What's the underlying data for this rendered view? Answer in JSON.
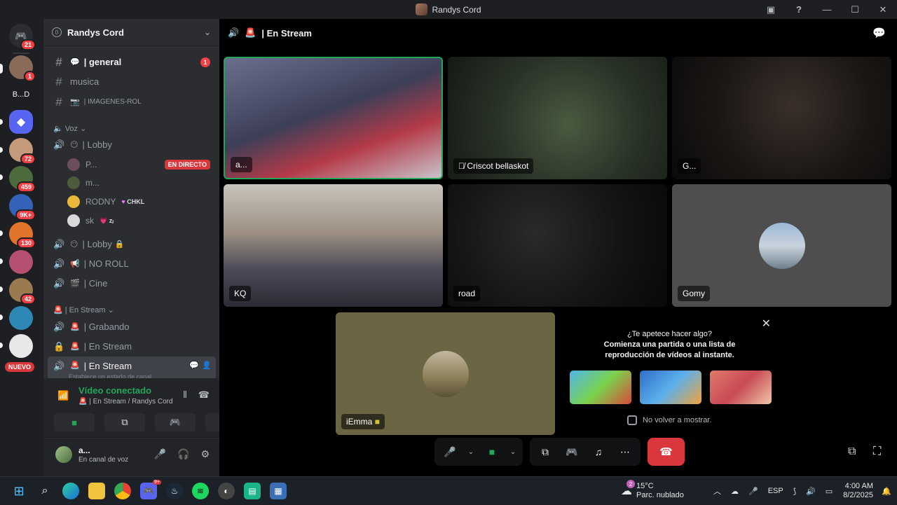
{
  "window": {
    "title": "Randys Cord"
  },
  "rail": {
    "servers": [
      {
        "badge": "21",
        "color": "#2b2d31"
      },
      {
        "badge": "1",
        "color": "#8a6a58"
      },
      {
        "label": "B...D",
        "color": "#1e1f22"
      },
      {
        "badge": "",
        "color": "#5865f2"
      },
      {
        "badge": "72",
        "color": "#c49a7a"
      },
      {
        "badge": "459",
        "color": "#4c6a3b"
      },
      {
        "badge": "9K+",
        "color": "#3462b8"
      },
      {
        "badge": "130",
        "color": "#e0742b"
      },
      {
        "badge": "",
        "color": "#b55070"
      },
      {
        "badge": "42",
        "color": "#9a7b4f"
      },
      {
        "badge": "",
        "color": "#2e88b5"
      },
      {
        "badge": "",
        "color": "#e8e8e8"
      },
      {
        "label": "NUEVO",
        "color": "#da373c"
      }
    ]
  },
  "sidebar": {
    "server_name": "Randys Cord",
    "channels": {
      "general": {
        "name": "| general",
        "badge": "1"
      },
      "musica": {
        "name": "musica"
      },
      "imagenes": {
        "name": "| IMAGENES-ROL"
      }
    },
    "category_voz": "Voz",
    "voice": {
      "lobby": "| Lobby",
      "lobby_users": [
        {
          "name": "P...",
          "live": "EN DIRECTO"
        },
        {
          "name": "m..."
        },
        {
          "name": "RODNY",
          "tag": "CHKL"
        },
        {
          "name": "sk",
          "tag": "💗 zⱼ"
        }
      ],
      "lobby2": "| Lobby",
      "noroll": "| NO ROLL",
      "cine": "| Cine"
    },
    "category_stream": "| En Stream",
    "stream_channels": {
      "grabando": "| Grabando",
      "enstream1": "| En Stream",
      "enstream2": "| En Stream",
      "status_hint": "Establece un estado de canal"
    },
    "voice_panel": {
      "title": "Vídeo conectado",
      "subtitle": "| En Stream / Randys Cord"
    },
    "user": {
      "name": "a...",
      "status": "En canal de voz"
    }
  },
  "main": {
    "header": "| En Stream",
    "tiles": [
      {
        "name": "a..."
      },
      {
        "name": "Criscot bellaskot"
      },
      {
        "name": "G..."
      },
      {
        "name": "KQ"
      },
      {
        "name": "road"
      },
      {
        "name": "Gomy"
      },
      {
        "name": "iEmma"
      }
    ],
    "activity": {
      "title": "¿Te apetece hacer algo?",
      "subtitle": "Comienza una partida o una lista de reproducción de vídeos al instante.",
      "checkbox": "No volver a mostrar."
    }
  },
  "taskbar": {
    "weather_temp": "15°C",
    "weather_desc": "Parc. nublado",
    "weather_badge": "2",
    "lang": "ESP",
    "time": "4:00 AM",
    "date": "8/2/2025",
    "discord_badge": "9+"
  },
  "colors": {
    "accent": "#5865f2",
    "green": "#23a55a",
    "red": "#da373c"
  }
}
